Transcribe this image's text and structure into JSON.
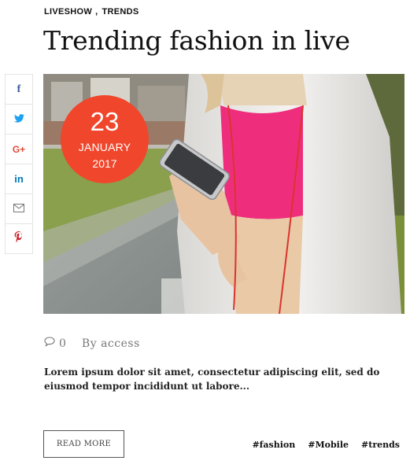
{
  "post": {
    "categories": [
      "LIVESHOW",
      "TRENDS"
    ],
    "category_separator": ",",
    "title": "Trending fashion in live",
    "date": {
      "day": "23",
      "month": "JANUARY",
      "year": "2017"
    },
    "comments_count": "0",
    "author_line": "By access",
    "excerpt": "Lorem ipsum dolor sit amet, consectetur adipiscing elit, sed do eiusmod tempor incididunt ut labore...",
    "read_more_label": "READ MORE",
    "tags": [
      "#fashion",
      "#Mobile",
      "#trends"
    ]
  },
  "share": [
    {
      "network": "facebook",
      "glyph": "f",
      "icon": "facebook-icon"
    },
    {
      "network": "twitter",
      "glyph": "🐦",
      "icon": "twitter-icon"
    },
    {
      "network": "google-plus",
      "glyph": "G+",
      "icon": "google-plus-icon"
    },
    {
      "network": "linkedin",
      "glyph": "in",
      "icon": "linkedin-icon"
    },
    {
      "network": "email",
      "glyph": "✉",
      "icon": "mail-icon"
    },
    {
      "network": "pinterest",
      "glyph": "P",
      "icon": "pinterest-icon"
    }
  ],
  "colors": {
    "accent": "#f0462c",
    "facebook": "#3b5998",
    "twitter": "#1da1f2",
    "google_plus": "#dd4b39",
    "linkedin": "#0077b5",
    "pinterest": "#cb2027"
  }
}
